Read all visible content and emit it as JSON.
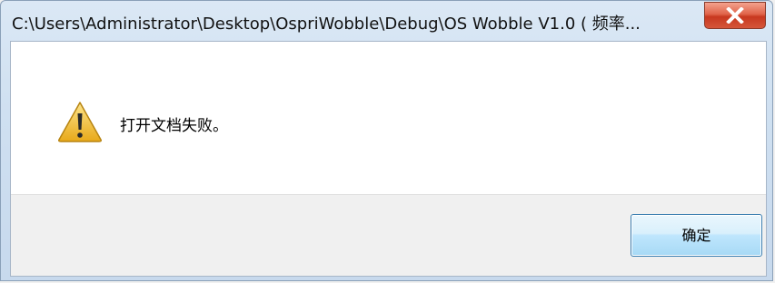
{
  "window": {
    "title": "C:\\Users\\Administrator\\Desktop\\OspriWobble\\Debug\\OS Wobble V1.0 ( 频率..."
  },
  "message": {
    "text": "打开文档失败。",
    "icon": "warning-icon"
  },
  "buttons": {
    "ok_label": "确定"
  },
  "colors": {
    "close_button": "#c8381f",
    "warning_fill": "#f2c232",
    "ok_border": "#3c7fb1"
  }
}
